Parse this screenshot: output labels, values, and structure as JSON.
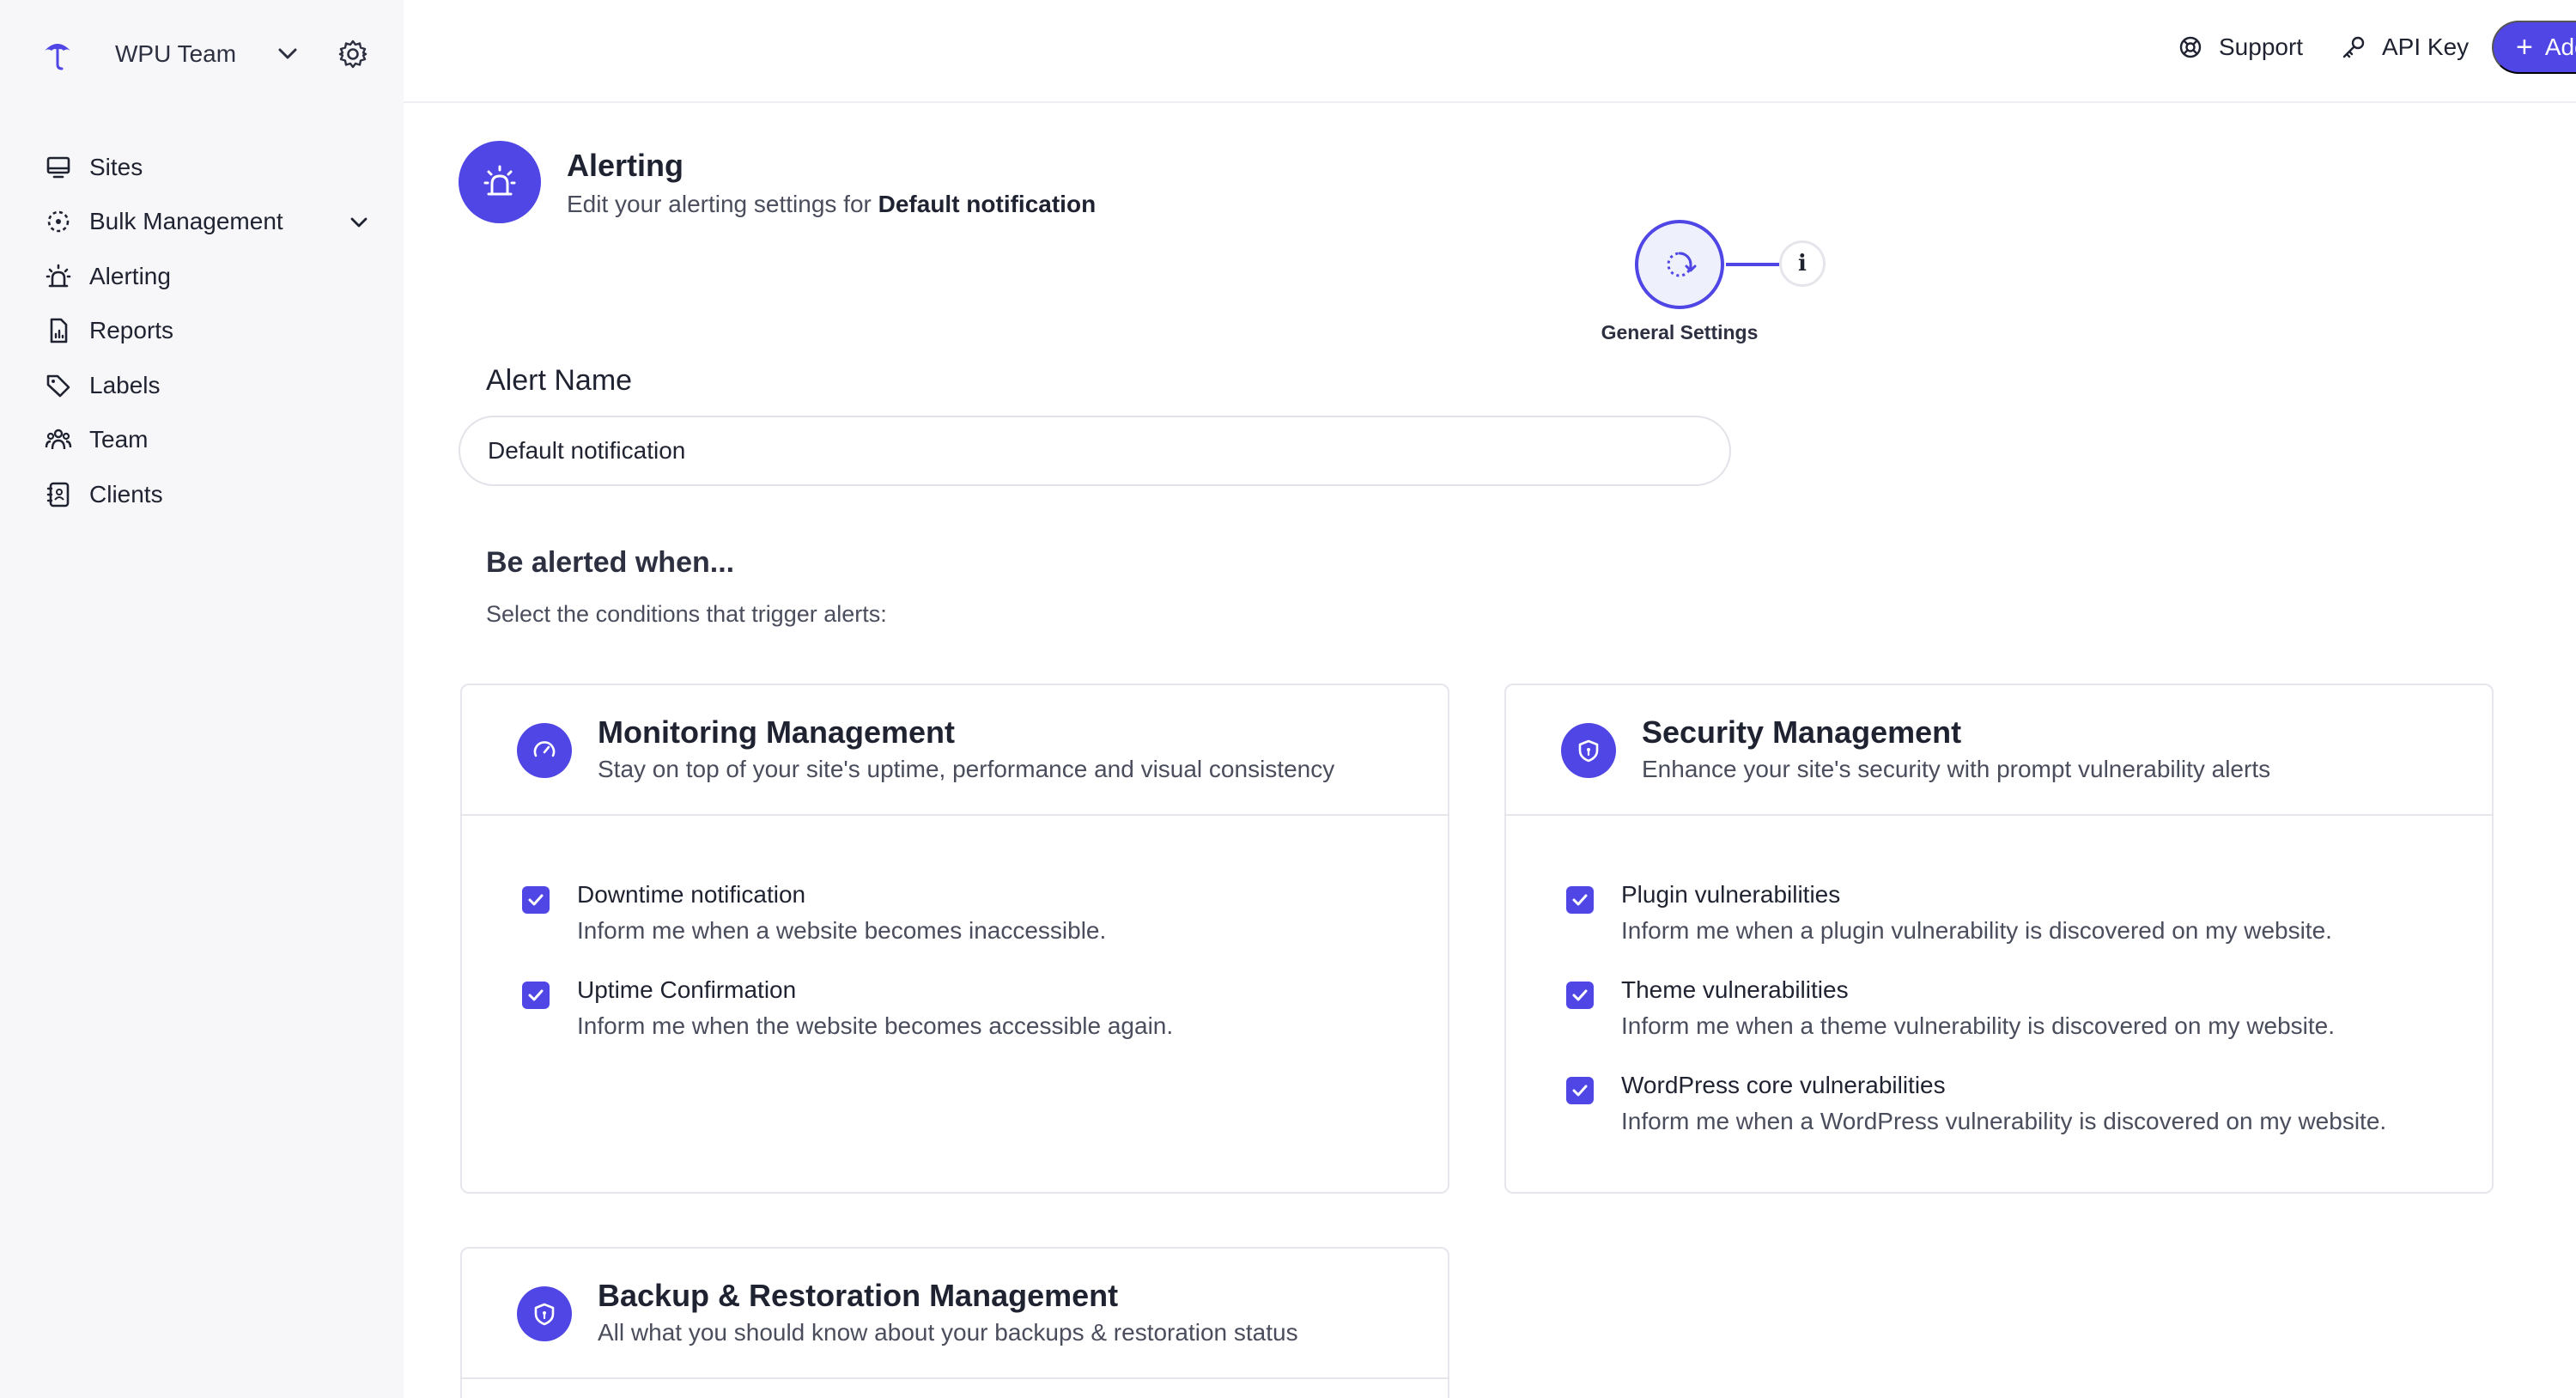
{
  "sidebar": {
    "team_name": "WPU Team",
    "items": [
      {
        "label": "Sites",
        "icon": "monitor-icon"
      },
      {
        "label": "Bulk Management",
        "icon": "bulk-icon"
      },
      {
        "label": "Alerting",
        "icon": "siren-icon"
      },
      {
        "label": "Reports",
        "icon": "report-icon"
      },
      {
        "label": "Labels",
        "icon": "tag-icon"
      },
      {
        "label": "Team",
        "icon": "team-icon"
      },
      {
        "label": "Clients",
        "icon": "clients-icon"
      }
    ]
  },
  "topbar": {
    "support_label": "Support",
    "api_key_label": "API Key",
    "add_label": "Add"
  },
  "header": {
    "title": "Alerting",
    "subtitle_prefix": "Edit your alerting settings for ",
    "subtitle_bold": "Default notification"
  },
  "stepper": {
    "step_label": "General Settings",
    "info_glyph": "i"
  },
  "alert_name": {
    "label": "Alert Name",
    "value": "Default notification"
  },
  "conditions": {
    "title": "Be alerted when...",
    "subtitle": "Select the conditions that trigger alerts:"
  },
  "cards": {
    "monitoring": {
      "title": "Monitoring Management",
      "description": "Stay on top of your site's uptime, performance and visual consistency",
      "options": [
        {
          "title": "Downtime notification",
          "description": "Inform me when a website becomes inaccessible.",
          "checked": true
        },
        {
          "title": "Uptime Confirmation",
          "description": "Inform me when the website becomes accessible again.",
          "checked": true
        }
      ]
    },
    "security": {
      "title": "Security Management",
      "description": "Enhance your site's security with prompt vulnerability alerts",
      "options": [
        {
          "title": "Plugin vulnerabilities",
          "description": "Inform me when a plugin vulnerability is discovered on my website.",
          "checked": true
        },
        {
          "title": "Theme vulnerabilities",
          "description": "Inform me when a theme vulnerability is discovered on my website.",
          "checked": true
        },
        {
          "title": "WordPress core vulnerabilities",
          "description": "Inform me when a WordPress vulnerability is discovered on my website.",
          "checked": true
        }
      ]
    },
    "backup": {
      "title": "Backup & Restoration Management",
      "description": "All what you should know about your backups & restoration status"
    }
  },
  "colors": {
    "accent": "#4f46e5",
    "sidebar_bg": "#f7f7f9",
    "border": "#e6e7ec"
  }
}
